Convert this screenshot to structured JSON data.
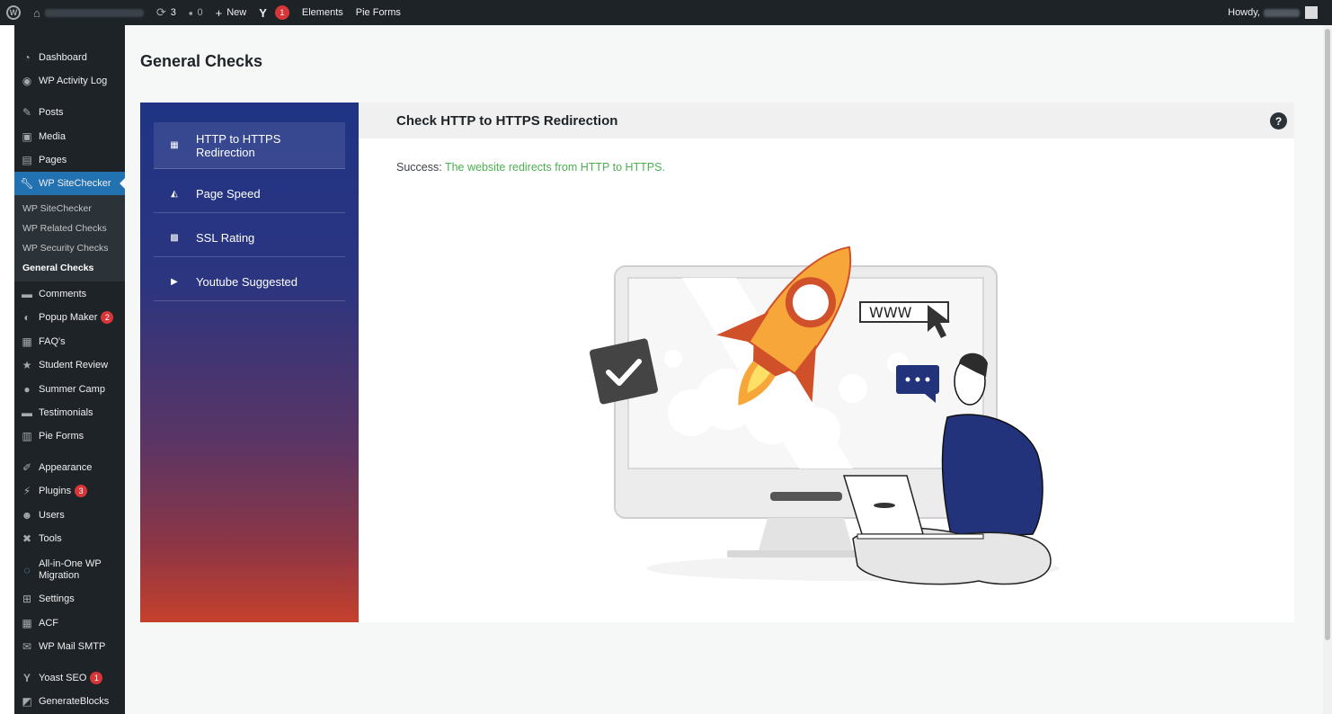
{
  "adminbar": {
    "updates_count": "3",
    "comments_count": "0",
    "new_label": "New",
    "yoast_badge": "1",
    "elements_label": "Elements",
    "pieforms_label": "Pie Forms",
    "howdy_label": "Howdy,"
  },
  "sidebar": {
    "items": [
      {
        "label": "Dashboard",
        "icon": "dashboard-icon"
      },
      {
        "label": "WP Activity Log",
        "icon": "eye-icon"
      },
      {
        "label": "Posts",
        "icon": "pin-icon"
      },
      {
        "label": "Media",
        "icon": "media-icon"
      },
      {
        "label": "Pages",
        "icon": "pages-icon"
      },
      {
        "label": "WP SiteChecker",
        "icon": "wrench-icon"
      },
      {
        "label": "Comments",
        "icon": "comment-icon"
      },
      {
        "label": "Popup Maker",
        "icon": "popup-icon",
        "badge": "2"
      },
      {
        "label": "FAQ's",
        "icon": "table-icon"
      },
      {
        "label": "Student Review",
        "icon": "star-icon"
      },
      {
        "label": "Summer Camp",
        "icon": "person-circle-icon"
      },
      {
        "label": "Testimonials",
        "icon": "quote-icon"
      },
      {
        "label": "Pie Forms",
        "icon": "form-icon"
      },
      {
        "label": "Appearance",
        "icon": "brush-icon"
      },
      {
        "label": "Plugins",
        "icon": "plug-icon",
        "badge": "3"
      },
      {
        "label": "Users",
        "icon": "user-icon"
      },
      {
        "label": "Tools",
        "icon": "tools-icon"
      },
      {
        "label": "All-in-One WP Migration",
        "icon": "migration-icon"
      },
      {
        "label": "Settings",
        "icon": "settings-icon"
      },
      {
        "label": "ACF",
        "icon": "acf-icon"
      },
      {
        "label": "WP Mail SMTP",
        "icon": "mail-icon"
      },
      {
        "label": "Yoast SEO",
        "icon": "yoast-icon",
        "badge": "1"
      },
      {
        "label": "GenerateBlocks",
        "icon": "blocks-icon"
      }
    ],
    "submenu": [
      "WP SiteChecker",
      "WP Related Checks",
      "WP Security Checks",
      "General Checks"
    ]
  },
  "page": {
    "title": "General Checks"
  },
  "checks": {
    "tabs": [
      {
        "label": "HTTP to HTTPS Redirection",
        "icon": "redirect-icon"
      },
      {
        "label": "Page Speed",
        "icon": "speed-icon"
      },
      {
        "label": "SSL Rating",
        "icon": "ssl-icon"
      },
      {
        "label": "Youtube Suggested",
        "icon": "youtube-icon"
      }
    ]
  },
  "panel": {
    "title": "Check HTTP to HTTPS Redirection",
    "status_label": "Success:",
    "status_message": "The website redirects from HTTP to HTTPS.",
    "illustration_text": "WWW"
  },
  "colors": {
    "wp_dark": "#1d2327",
    "wp_blue": "#2271b1",
    "success_green": "#4caf50",
    "gradient_top": "#1f3485",
    "gradient_bottom": "#c5402c"
  }
}
